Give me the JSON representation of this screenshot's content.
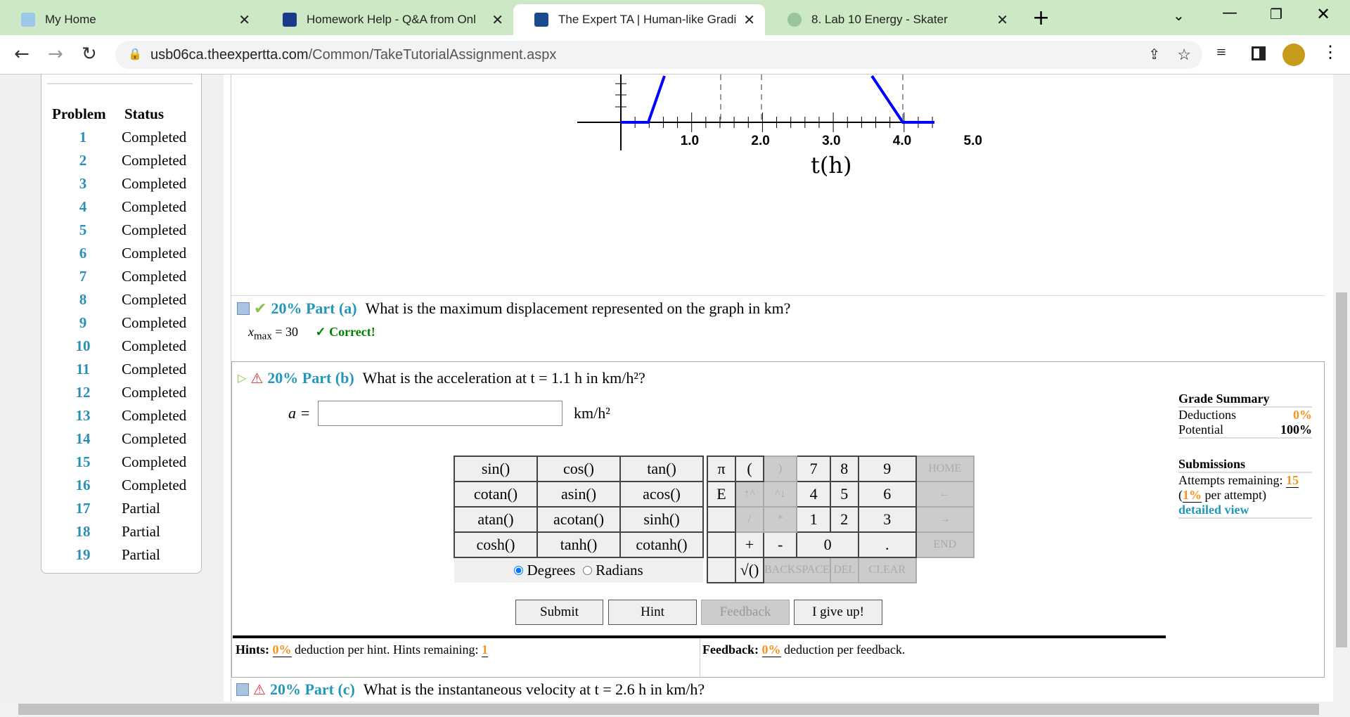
{
  "browser": {
    "tabs": [
      {
        "title": "My Home"
      },
      {
        "title": "Homework Help - Q&A from Onl"
      },
      {
        "title": "The Expert TA | Human-like Gradi",
        "active": true
      },
      {
        "title": "8. Lab 10 Energy - Skater"
      }
    ],
    "url_host": "usb06ca.theexpertta.com",
    "url_path": "/Common/TakeTutorialAssignment.aspx"
  },
  "sidebar": {
    "col_problem": "Problem",
    "col_status": "Status",
    "problems": [
      {
        "n": "1",
        "s": "Completed"
      },
      {
        "n": "2",
        "s": "Completed"
      },
      {
        "n": "3",
        "s": "Completed"
      },
      {
        "n": "4",
        "s": "Completed"
      },
      {
        "n": "5",
        "s": "Completed"
      },
      {
        "n": "6",
        "s": "Completed"
      },
      {
        "n": "7",
        "s": "Completed"
      },
      {
        "n": "8",
        "s": "Completed"
      },
      {
        "n": "9",
        "s": "Completed"
      },
      {
        "n": "10",
        "s": "Completed"
      },
      {
        "n": "11",
        "s": "Completed"
      },
      {
        "n": "12",
        "s": "Completed"
      },
      {
        "n": "13",
        "s": "Completed"
      },
      {
        "n": "14",
        "s": "Completed"
      },
      {
        "n": "15",
        "s": "Completed"
      },
      {
        "n": "16",
        "s": "Completed"
      },
      {
        "n": "17",
        "s": "Partial"
      },
      {
        "n": "18",
        "s": "Partial"
      },
      {
        "n": "19",
        "s": "Partial"
      }
    ]
  },
  "graph": {
    "x_ticks": [
      "1.0",
      "2.0",
      "3.0",
      "4.0",
      "5.0"
    ],
    "x_label": "t(h)",
    "line_color": "#0000ff"
  },
  "part_a": {
    "label": "20% Part (a)",
    "question": "What is the maximum displacement represented on the graph in km?",
    "answer_var": "x",
    "answer_sub": "max",
    "answer": "= 30",
    "result": "✓ Correct!"
  },
  "part_b": {
    "label": "20% Part (b)",
    "question": "What is the acceleration at t = 1.1 h in km/h²?",
    "var": "a =",
    "input_value": "",
    "unit": "km/h²",
    "calc": {
      "func_rows": [
        [
          "sin()",
          "cos()",
          "tan()"
        ],
        [
          "cotan()",
          "asin()",
          "acos()"
        ],
        [
          "atan()",
          "acotan()",
          "sinh()"
        ],
        [
          "cosh()",
          "tanh()",
          "cotanh()"
        ]
      ],
      "degrees": "Degrees",
      "radians": "Radians",
      "mode": "Degrees",
      "keys": {
        "pi": "π",
        "lparen": "(",
        "rparen": ")",
        "k7": "7",
        "k8": "8",
        "k9": "9",
        "home": "HOME",
        "e": "E",
        "up": "↑^",
        "down": "^↓",
        "k4": "4",
        "k5": "5",
        "k6": "6",
        "left": "←",
        "div": "/",
        "mul": "*",
        "k1": "1",
        "k2": "2",
        "k3": "3",
        "right": "→",
        "plus": "+",
        "minus": "-",
        "k0": "0",
        "dot": ".",
        "end": "END",
        "sqrt": "√()",
        "backspace": "BACKSPACE",
        "del": "DEL",
        "clear": "CLEAR"
      }
    },
    "buttons": {
      "submit": "Submit",
      "hint": "Hint",
      "feedback": "Feedback",
      "giveup": "I give up!"
    },
    "hints": {
      "label": "Hints:",
      "pct": "0%",
      "text": "deduction per hint. Hints remaining:",
      "remaining": "1"
    },
    "feedback": {
      "label": "Feedback:",
      "pct": "0%",
      "text": "deduction per feedback."
    }
  },
  "grade": {
    "title": "Grade Summary",
    "deductions_label": "Deductions",
    "deductions": "0%",
    "potential_label": "Potential",
    "potential": "100%",
    "submissions_title": "Submissions",
    "attempts_label": "Attempts remaining:",
    "attempts": "15",
    "per_pct": "1%",
    "per_text": "per attempt)",
    "detailed": "detailed view"
  },
  "part_c": {
    "label": "20% Part (c)",
    "question": "What is the instantaneous velocity at t = 2.6 h in km/h?"
  }
}
